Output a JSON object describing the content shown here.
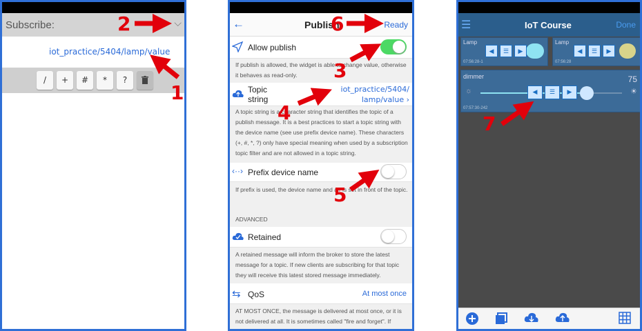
{
  "panel1": {
    "title": "Subscribe:",
    "chevron": "⌵",
    "topic": "iot_practice/5404/lamp/value",
    "keys": [
      "/",
      "+",
      "#",
      "*",
      "?"
    ],
    "delete_icon": "trash-icon"
  },
  "panel2": {
    "back_icon": "←",
    "title": "Publish",
    "ready": "Ready",
    "allow_publish": "Allow publish",
    "allow_desc": "If publish is allowed, the widget is able to change value, otherwise it behaves as read-only.",
    "topic_label": "Topic string",
    "topic_value_line1": "iot_practice/5404/",
    "topic_value_line2": "lamp/value",
    "topic_desc": "A topic string is a character string that identifies the topic of a publish message. It is a best practices to start a topic string with the device name (see use prefix device name). These characters (+, #, *, ?) only have special meaning when used by a subscription topic filter and are not allowed in a topic string.",
    "prefix_label": "Prefix device name",
    "prefix_desc": "If prefix is used, the device name and a / is set in front of the topic.",
    "advanced": "ADVANCED",
    "retained_label": "Retained",
    "retained_desc": "A retained message will inform the broker to store the latest message for a topic. If new clients are subscribing for that topic they will receive this latest stored message immediately.",
    "qos_label": "QoS",
    "qos_value": "At most once",
    "qos_desc": "AT MOST ONCE, the message is delivered at most once, or it is not delivered at all. It is sometimes called \"fire and forget\". If"
  },
  "panel3": {
    "menu_icon": "☰",
    "title": "IoT Course",
    "done": "Done",
    "tiles": [
      {
        "name": "Lamp",
        "ts": "07:56:28-1"
      },
      {
        "name": "Lamp",
        "ts": "07:56:28"
      }
    ],
    "dimmer": {
      "name": "dimmer",
      "value": "75",
      "ts": "07:57:30-242",
      "level": 0.75
    }
  },
  "annotations": [
    "1",
    "2",
    "3",
    "4",
    "5",
    "6",
    "7"
  ],
  "colors": {
    "accent": "#2a6ad8",
    "arrow": "#e2000b",
    "toggle_on": "#4cd964"
  }
}
